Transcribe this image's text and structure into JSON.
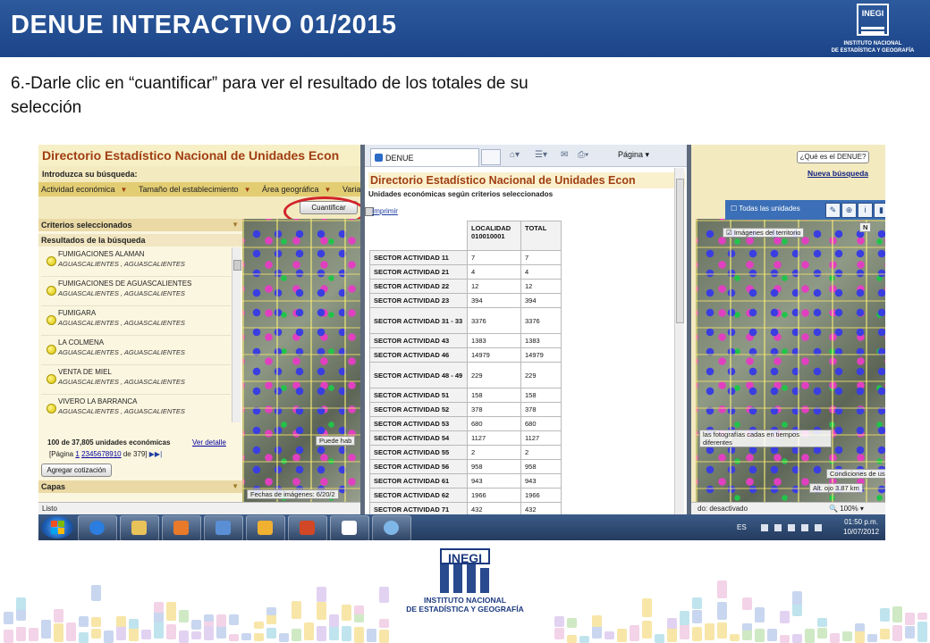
{
  "slide": {
    "title": "DENUE INTERACTIVO 01/2015",
    "instruction": "6.-Darle clic en “cuantificar” para ver el resultado de los totales de su selección",
    "logo_word": "INEGI",
    "logo_sub1": "INSTITUTO NACIONAL",
    "logo_sub2": "DE ESTADÍSTICA Y GEOGRAFÍA"
  },
  "app": {
    "title": "Directorio Estadístico Nacional de Unidades Econ",
    "search_label": "Introduzca su búsqueda:",
    "filters": [
      "Actividad económica",
      "Tamaño del establecimiento",
      "Área geográfica",
      "Varia"
    ],
    "cuantificar_label": "Cuantificar",
    "que_es_label": "¿Qué es el DENUE?",
    "nueva_busqueda": "Nueva búsqueda",
    "sections": {
      "criterios": "Criterios seleccionados",
      "resultados": "Resultados de la búsqueda",
      "capas": "Capas"
    },
    "results": [
      {
        "name": "FUMIGACIONES ALAMAN",
        "location": "AGUASCALIENTES , AGUASCALIENTES"
      },
      {
        "name": "FUMIGACIONES DE AGUASCALIENTES",
        "location": "AGUASCALIENTES , AGUASCALIENTES"
      },
      {
        "name": "FUMIGARA",
        "location": "AGUASCALIENTES , AGUASCALIENTES"
      },
      {
        "name": "LA COLMENA",
        "location": "AGUASCALIENTES , AGUASCALIENTES"
      },
      {
        "name": "VENTA DE MIEL",
        "location": "AGUASCALIENTES , AGUASCALIENTES"
      },
      {
        "name": "VIVERO LA BARRANCA",
        "location": "AGUASCALIENTES , AGUASCALIENTES"
      }
    ],
    "count_text": "100 de 37,805 unidades económicas",
    "ver_detalle": "Ver detalle",
    "pages_prefix": "[Página",
    "pages": [
      "1",
      "2",
      "3",
      "4",
      "5",
      "6",
      "7",
      "8",
      "9",
      "10"
    ],
    "pages_suffix": "de 379]",
    "agregar_label": "Agregar cotización",
    "map_toolbar_label": "Todas las unidades",
    "map_images_label": "Imágenes del territorio",
    "map_north": "N",
    "map_date": "Fechas de imágenes: 6/20/2",
    "map_notice_left": "Puede hab",
    "map_notice": "las fotografías cadas en tiempos diferentes",
    "map_conditions": "Condiciones de uso",
    "map_alt": "Alt. ojo   3.87 km",
    "status_left": "Listo",
    "status_right": "do: desactivado",
    "zoom": "100%"
  },
  "popup": {
    "tab_label": "DENUE",
    "pagina_label": "Página",
    "title": "Directorio Estadístico Nacional de Unidades Econ",
    "subtitle": "Unidades económicas según criterios seleccionados",
    "print_label": "Imprimir",
    "headers": [
      "",
      "LOCALIDAD 010010001",
      "TOTAL"
    ],
    "rows": [
      {
        "sector": "SECTOR ACTIVIDAD 11",
        "localidad": "7",
        "total": "7"
      },
      {
        "sector": "SECTOR ACTIVIDAD 21",
        "localidad": "4",
        "total": "4"
      },
      {
        "sector": "SECTOR ACTIVIDAD 22",
        "localidad": "12",
        "total": "12"
      },
      {
        "sector": "SECTOR ACTIVIDAD 23",
        "localidad": "394",
        "total": "394"
      },
      {
        "sector": "SECTOR ACTIVIDAD 31 - 33",
        "localidad": "3376",
        "total": "3376"
      },
      {
        "sector": "SECTOR ACTIVIDAD 43",
        "localidad": "1383",
        "total": "1383"
      },
      {
        "sector": "SECTOR ACTIVIDAD 46",
        "localidad": "14979",
        "total": "14979"
      },
      {
        "sector": "SECTOR ACTIVIDAD 48 - 49",
        "localidad": "229",
        "total": "229"
      },
      {
        "sector": "SECTOR ACTIVIDAD 51",
        "localidad": "158",
        "total": "158"
      },
      {
        "sector": "SECTOR ACTIVIDAD 52",
        "localidad": "378",
        "total": "378"
      },
      {
        "sector": "SECTOR ACTIVIDAD 53",
        "localidad": "680",
        "total": "680"
      },
      {
        "sector": "SECTOR ACTIVIDAD 54",
        "localidad": "1127",
        "total": "1127"
      },
      {
        "sector": "SECTOR ACTIVIDAD 55",
        "localidad": "2",
        "total": "2"
      },
      {
        "sector": "SECTOR ACTIVIDAD 56",
        "localidad": "958",
        "total": "958"
      },
      {
        "sector": "SECTOR ACTIVIDAD 61",
        "localidad": "943",
        "total": "943"
      },
      {
        "sector": "SECTOR ACTIVIDAD 62",
        "localidad": "1966",
        "total": "1966"
      },
      {
        "sector": "SECTOR ACTIVIDAD 71",
        "localidad": "432",
        "total": "432"
      }
    ]
  },
  "taskbar": {
    "lang": "ES",
    "time": "01:50 p.m.",
    "date": "10/07/2012"
  },
  "colors": {
    "header_blue": "#1c4489",
    "title_orange": "#a03e12",
    "highlight_red": "#d2232a"
  }
}
